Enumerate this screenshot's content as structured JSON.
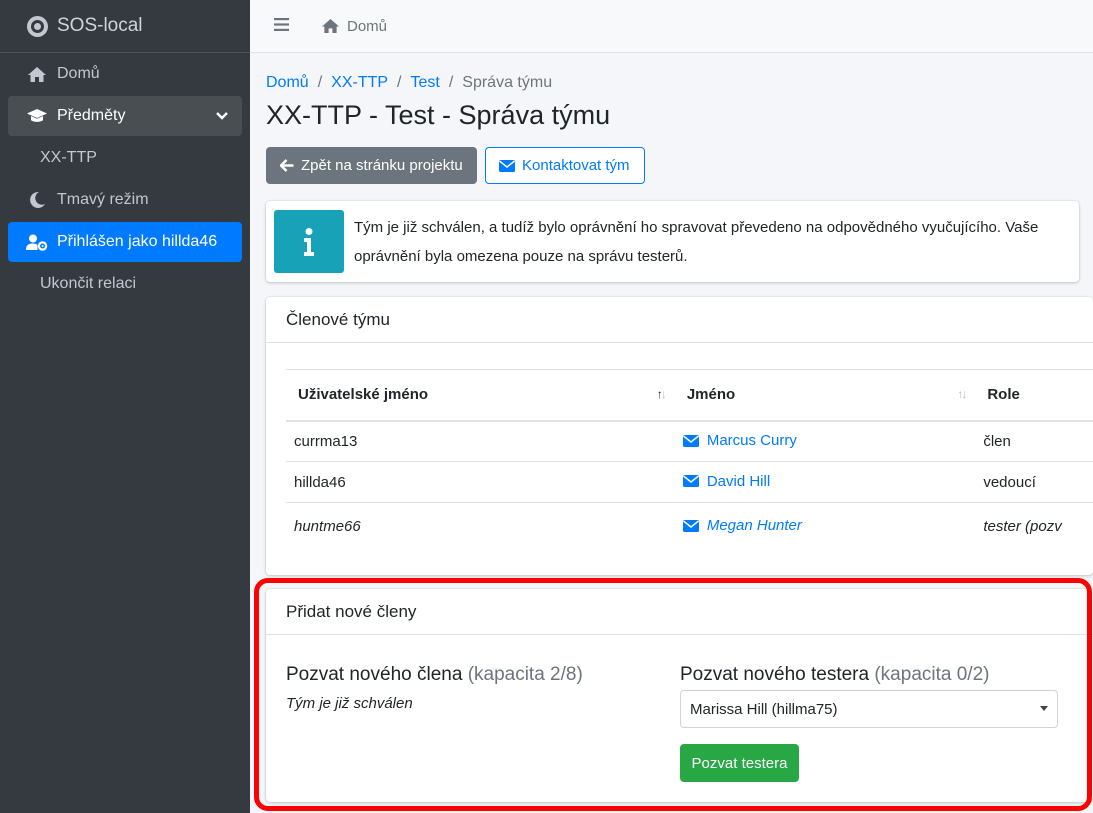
{
  "sidebar": {
    "brand": "SOS-local",
    "items": [
      {
        "label": "Domů",
        "icon": "home-icon"
      },
      {
        "label": "Předměty",
        "icon": "graduation-cap-icon"
      },
      {
        "label": "XX-TTP"
      },
      {
        "label": "Tmavý režim",
        "icon": "moon-icon"
      },
      {
        "label": "Přihlášen jako hillda46",
        "icon": "user-cog-icon"
      },
      {
        "label": "Ukončit relaci"
      }
    ]
  },
  "topbar": {
    "home": "Domů"
  },
  "breadcrumb": [
    "Domů",
    "XX-TTP",
    "Test",
    "Správa týmu"
  ],
  "title": "XX-TTP - Test - Správa týmu",
  "buttons": {
    "back": "Zpět na stránku projektu",
    "contact": "Kontaktovat tým"
  },
  "callout": "Tým je již schválen, a tudíž bylo oprávnění ho spravovat převedeno na odpovědného vyučujícího. Vaše oprávnění byla omezena pouze na správu testerů.",
  "members": {
    "header": "Členové týmu",
    "columns": [
      "Uživatelské jméno",
      "Jméno",
      "Role"
    ],
    "rows": [
      {
        "username": "currma13",
        "name": "Marcus Curry",
        "role": "člen"
      },
      {
        "username": "hillda46",
        "name": "David Hill",
        "role": "vedoucí"
      },
      {
        "username": "huntme66",
        "name": "Megan Hunter",
        "role": "tester (pozv"
      }
    ]
  },
  "add": {
    "header": "Přidat nové členy",
    "member_title": "Pozvat nového člena",
    "member_capacity": "(kapacita 2/8)",
    "approved_note": "Tým je již schválen",
    "tester_title": "Pozvat nového testera",
    "tester_capacity": "(kapacita 0/2)",
    "selected_tester": "Marissa Hill (hillma75)",
    "invite_button": "Pozvat testera"
  },
  "colors": {
    "primary": "#007bff",
    "sidebar": "#343a40",
    "info": "#17a2b8",
    "success": "#28a745",
    "highlight": "#ff0000"
  }
}
